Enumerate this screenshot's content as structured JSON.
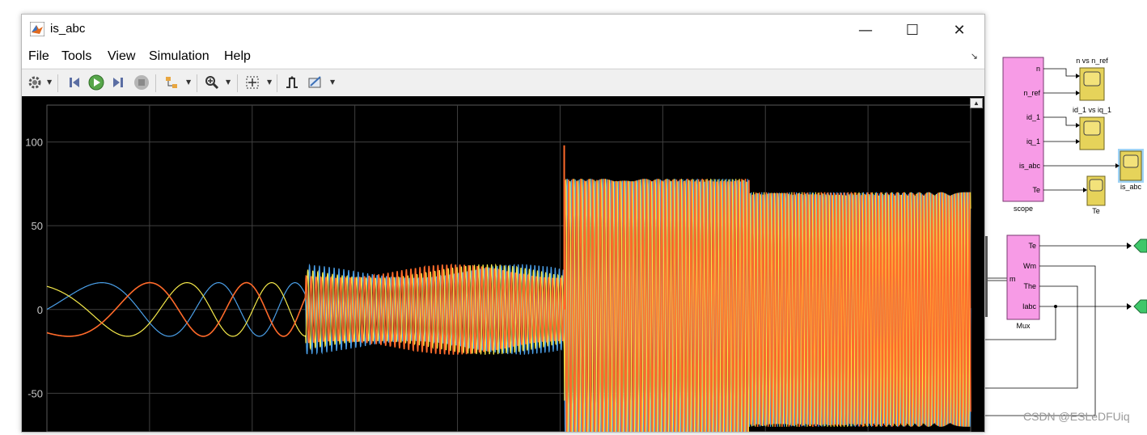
{
  "window": {
    "title": "is_abc",
    "controls": {
      "minimize": "—",
      "maximize": "☐",
      "close": "✕"
    }
  },
  "menu": {
    "items": [
      "File",
      "Tools",
      "View",
      "Simulation",
      "Help"
    ]
  },
  "toolbar": {
    "icons": [
      "gear-icon",
      "step-back-icon",
      "run-icon",
      "step-forward-icon",
      "stop-icon",
      "highlight-icon",
      "zoom-icon",
      "autoscale-icon",
      "triggers-icon",
      "measurements-icon"
    ]
  },
  "chart_data": {
    "type": "line",
    "title": "",
    "xlabel": "",
    "ylabel": "",
    "ylim": [
      -73,
      122
    ],
    "yticks": [
      "100",
      "50",
      "0",
      "-50"
    ],
    "ytick_values": [
      100,
      50,
      0,
      -50
    ],
    "grid": true,
    "series": [
      {
        "color": "#4a9fe8"
      },
      {
        "color": "#f5e94a"
      },
      {
        "color": "#ff6a2a"
      }
    ],
    "segments": [
      {
        "x_start": 0.0,
        "x_end": 0.28,
        "amplitude": 16
      },
      {
        "x_start": 0.28,
        "x_end": 0.56,
        "amplitude": 27
      },
      {
        "x_start": 0.56,
        "x_end": 0.76,
        "amplitude": 78
      },
      {
        "x_start": 0.76,
        "x_end": 1.0,
        "amplitude": 70
      }
    ],
    "spike": 98
  },
  "diagram": {
    "scope_block": {
      "label": "scope",
      "ports": [
        "n",
        "n_ref",
        "id_1",
        "iq_1",
        "is_abc",
        "Te"
      ]
    },
    "scopes": [
      "n vs n_ref",
      "id_1 vs iq_1",
      "is_abc",
      "Te"
    ],
    "mux_block": {
      "label": "Mux",
      "inputs": [
        "m"
      ],
      "outputs": [
        "Te",
        "Wm",
        "The",
        "Iabc"
      ]
    }
  },
  "watermark": "CSDN @ESLeDFUiq",
  "colors": {
    "scope_block": "#f79be6",
    "scope_icon": "#e6d35a",
    "goto": "#3fc76a",
    "plot_bg": "#000000",
    "grid": "#404040"
  }
}
